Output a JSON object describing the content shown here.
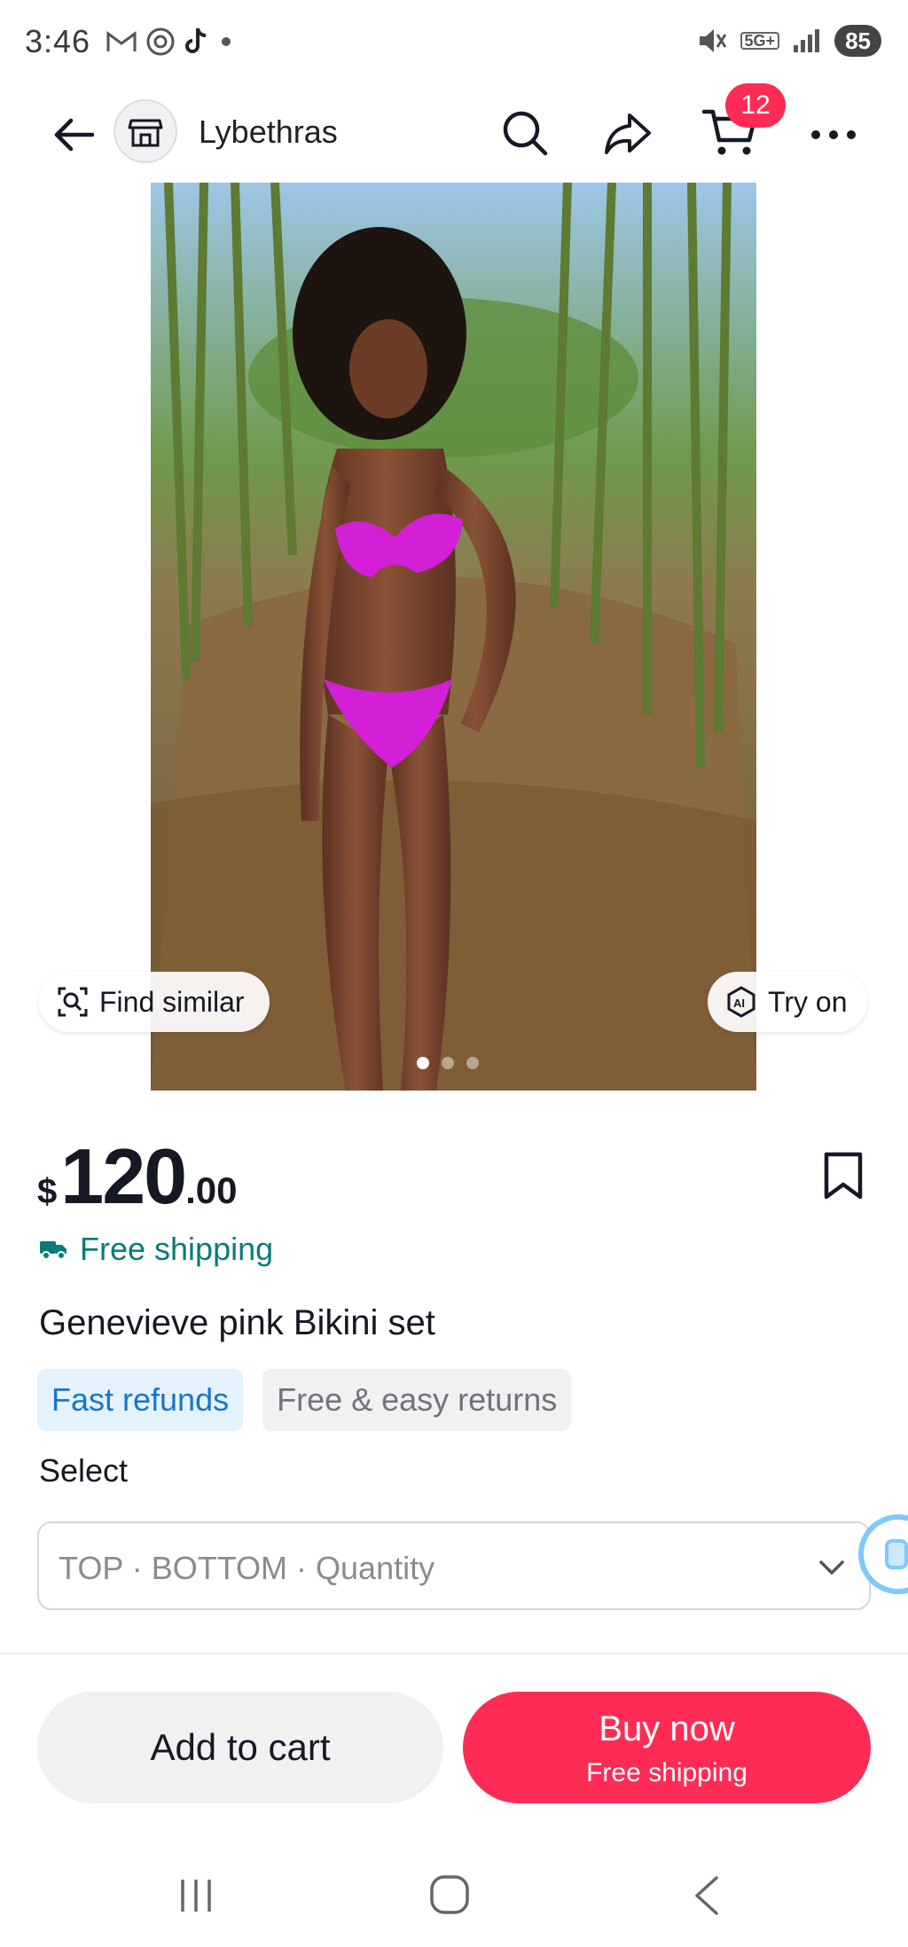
{
  "status_bar": {
    "time": "3:46",
    "network": "5G+",
    "battery": "85"
  },
  "header": {
    "store_name": "Lybethras",
    "cart_count": "12"
  },
  "image": {
    "find_similar_label": "Find similar",
    "try_on_label": "Try on",
    "page_count": 3,
    "active_page": 1
  },
  "product": {
    "currency": "$",
    "price_whole": "120",
    "price_cents": ".00",
    "shipping": "Free shipping",
    "title": "Genevieve pink Bikini set",
    "tags": [
      "Fast refunds",
      "Free & easy returns"
    ],
    "select_label": "Select",
    "variant_placeholder": "TOP · BOTTOM · Quantity"
  },
  "actions": {
    "add_to_cart": "Add to cart",
    "buy_now": "Buy now",
    "buy_now_sub": "Free shipping"
  },
  "colors": {
    "accent": "#fe2c55",
    "shipping_teal": "#0a7b78",
    "tag_blue_text": "#1876c6",
    "tag_blue_bg": "#e4f2fd",
    "bikini_magenta": "#d31fd6"
  },
  "icons": {
    "back": "arrow-left-icon",
    "store": "store-icon",
    "search": "search-icon",
    "share": "share-icon",
    "cart": "cart-icon",
    "more": "more-icon",
    "bookmark": "bookmark-icon",
    "truck": "truck-icon",
    "chevron": "chevron-down-icon",
    "find_similar": "image-search-icon",
    "try_on": "ai-try-on-icon"
  }
}
